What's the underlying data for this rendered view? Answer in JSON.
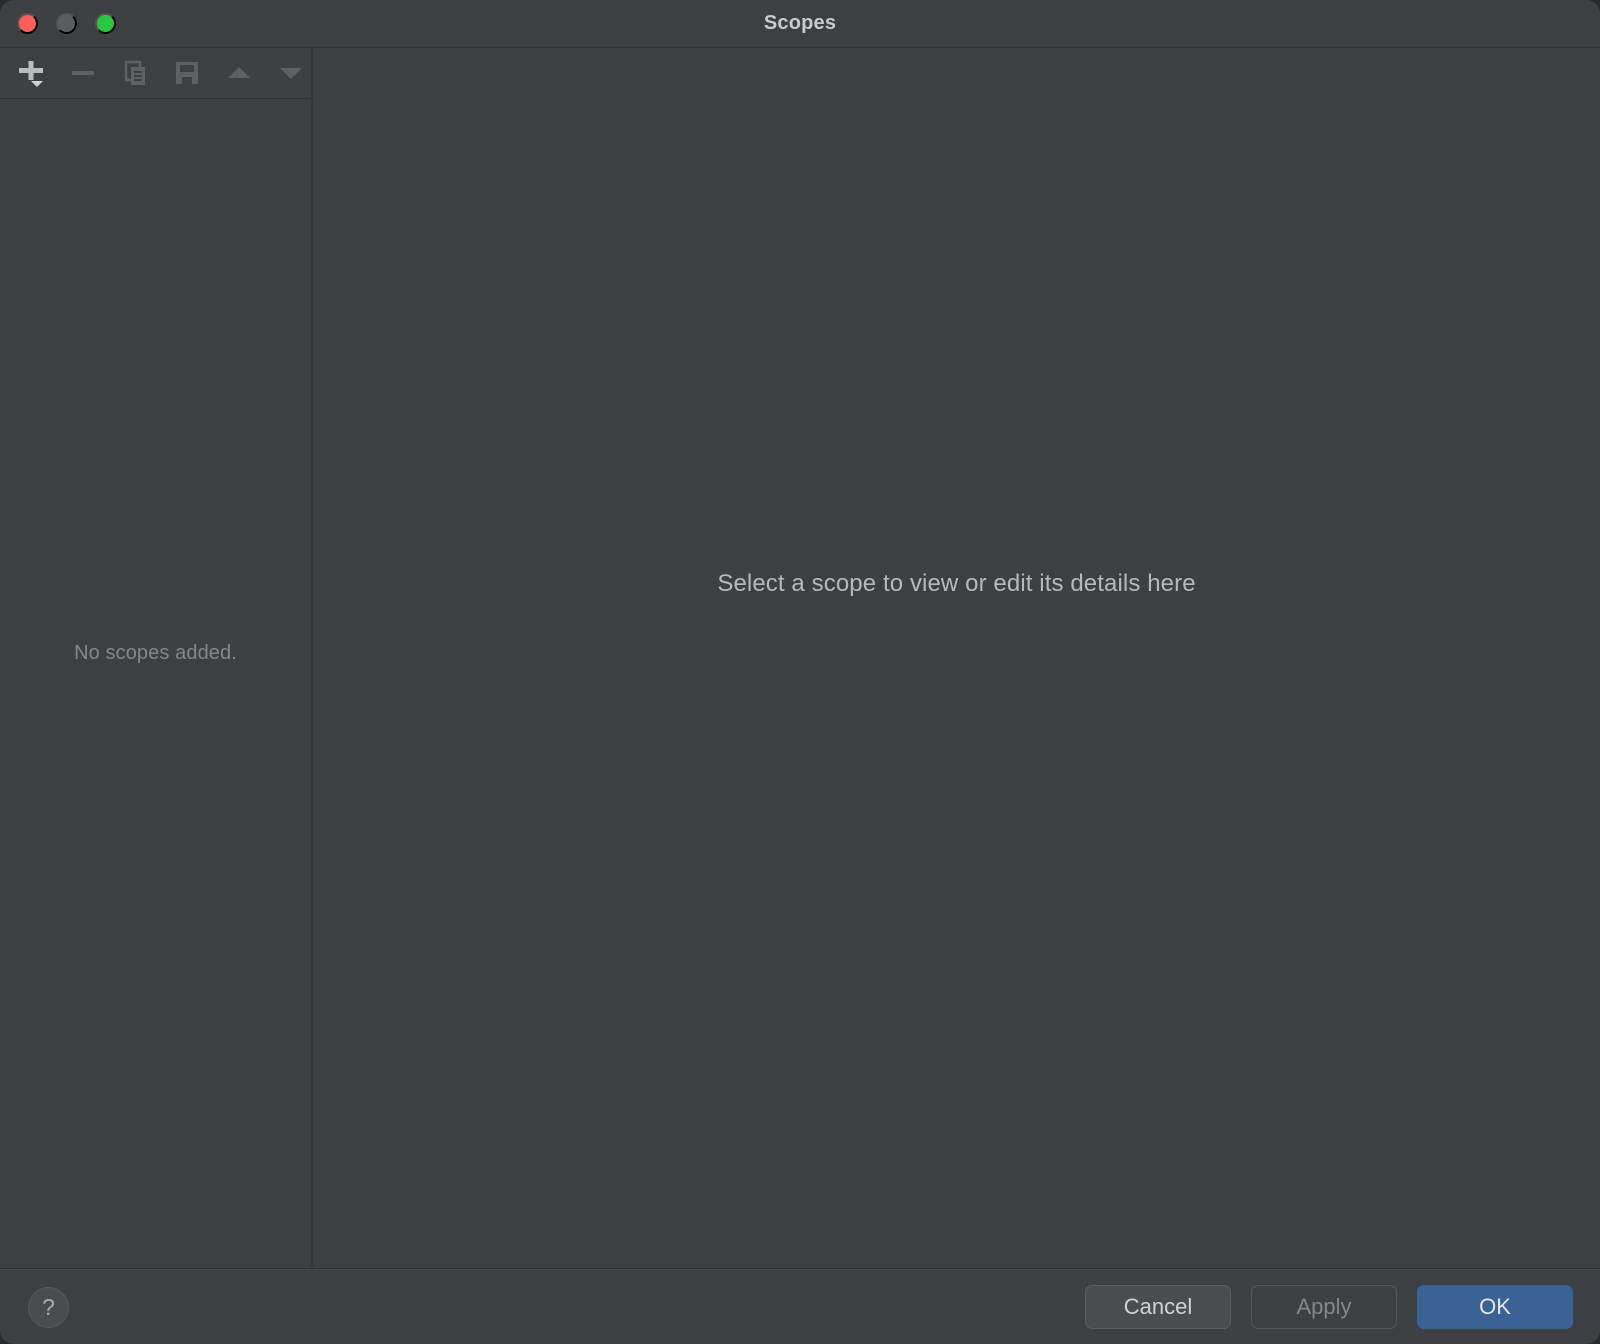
{
  "window": {
    "title": "Scopes",
    "traffic_lights": [
      {
        "name": "close",
        "color": "#ff5f57"
      },
      {
        "name": "minimize",
        "color": "#5b5e61"
      },
      {
        "name": "zoom",
        "color": "#28c840"
      }
    ]
  },
  "toolbar": {
    "items": [
      {
        "icon": "add-icon",
        "label": "Add scope",
        "enabled": true,
        "has_dropdown": true
      },
      {
        "icon": "remove-icon",
        "label": "Remove scope",
        "enabled": false,
        "has_dropdown": false
      },
      {
        "icon": "copy-icon",
        "label": "Duplicate scope",
        "enabled": false,
        "has_dropdown": false
      },
      {
        "icon": "save-icon",
        "label": "Save scope",
        "enabled": false,
        "has_dropdown": false
      },
      {
        "icon": "move-up-icon",
        "label": "Move up",
        "enabled": false,
        "has_dropdown": false
      },
      {
        "icon": "move-down-icon",
        "label": "Move down",
        "enabled": false,
        "has_dropdown": false
      }
    ]
  },
  "sidebar": {
    "empty_message": "No scopes added."
  },
  "detail": {
    "placeholder": "Select a scope to view or edit its details here"
  },
  "footer": {
    "help_label": "?",
    "buttons": [
      {
        "label": "Cancel",
        "style": "secondary",
        "enabled": true
      },
      {
        "label": "Apply",
        "style": "disabled",
        "enabled": false
      },
      {
        "label": "OK",
        "style": "primary",
        "enabled": true
      }
    ]
  },
  "colors": {
    "window_background": "#3c4043",
    "divider": "#303336",
    "primary_button": "#3b6295",
    "text_primary": "#c8cacb",
    "text_muted": "#83878a",
    "icon_enabled": "#b9bcbe",
    "icon_disabled": "#5e6164"
  }
}
